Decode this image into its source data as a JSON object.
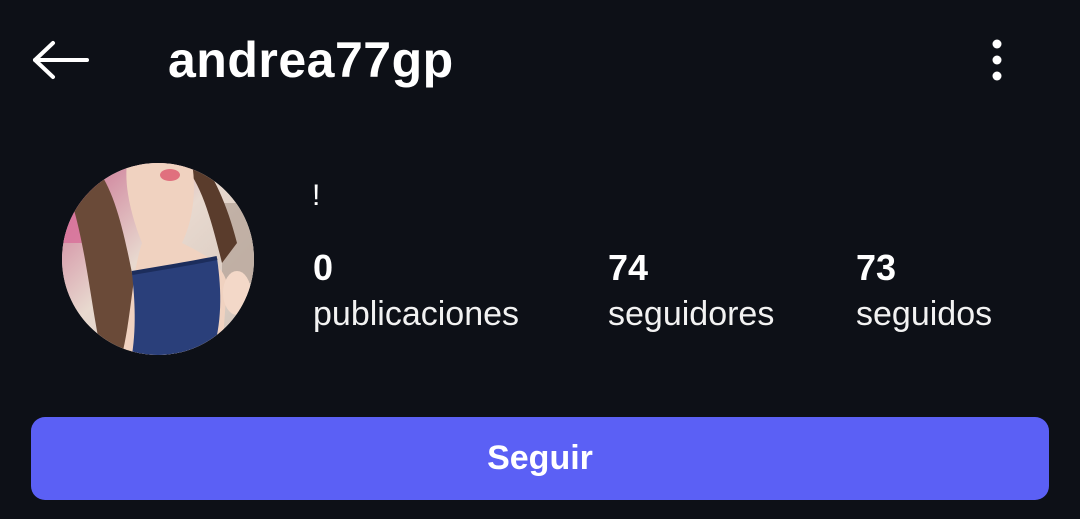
{
  "header": {
    "username": "andrea77gp",
    "back_icon": "arrow-left-icon",
    "more_icon": "more-vertical-icon"
  },
  "profile": {
    "avatar_icon": "profile-photo",
    "bio": "!"
  },
  "stats": {
    "posts": {
      "value": "0",
      "label": "publicaciones"
    },
    "followers": {
      "value": "74",
      "label": "seguidores"
    },
    "following": {
      "value": "73",
      "label": "seguidos"
    }
  },
  "actions": {
    "follow_label": "Seguir"
  },
  "colors": {
    "background": "#0d1017",
    "accent": "#5b60f5",
    "text": "#ffffff"
  }
}
